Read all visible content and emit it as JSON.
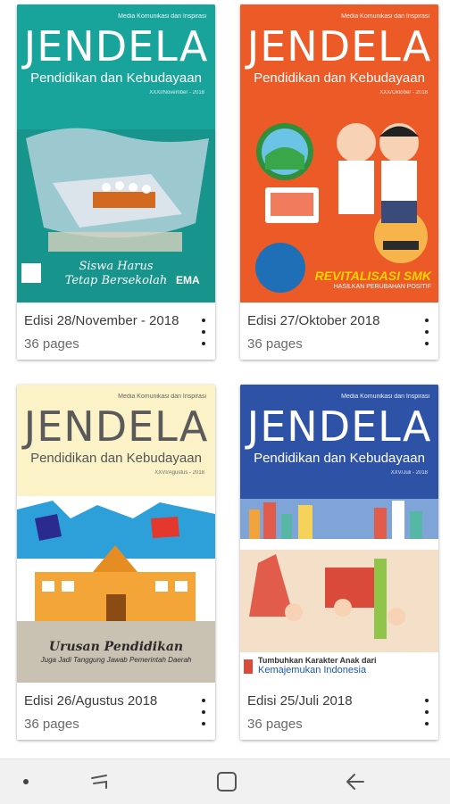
{
  "publications": [
    {
      "edition": "Edisi 28/November - 2018",
      "pages": "36 pages",
      "cover": {
        "kicker": "Media Komunikasi dan Inspirasi",
        "title": "JENDELA",
        "subtitle": "Pendidikan dan Kebudayaan",
        "issue": "XXXI/November - 2018",
        "headline_line1": "Siswa Harus",
        "headline_line2": "Tetap Bersekolah",
        "logo_text": "EMA",
        "bg": "#1aa39a"
      }
    },
    {
      "edition": "Edisi 27/Oktober 2018",
      "pages": "36 pages",
      "cover": {
        "kicker": "Media Komunikasi dan Inspirasi",
        "title": "JENDELA",
        "subtitle": "Pendidikan dan Kebudayaan",
        "issue": "XXX/Oktober - 2018",
        "headline_line1": "REVITALISASI SMK",
        "headline_line2": "HASILKAN PERUBAHAN POSITIF",
        "bg": "#ec5a27"
      }
    },
    {
      "edition": "Edisi 26/Agustus 2018",
      "pages": "36 pages",
      "cover": {
        "kicker": "Media Komunikasi dan Inspirasi",
        "title": "JENDELA",
        "subtitle": "Pendidikan dan Kebudayaan",
        "issue": "XXVI/Agustus - 2018",
        "headline_line1": "Urusan Pendidikan",
        "headline_line2": "Juga Jadi Tanggung Jawab Pemerintah Daerah",
        "bg": "#fbf2c8"
      }
    },
    {
      "edition": "Edisi 25/Juli 2018",
      "pages": "36 pages",
      "cover": {
        "kicker": "Media Komunikasi dan Inspirasi",
        "title": "JENDELA",
        "subtitle": "Pendidikan dan Kebudayaan",
        "issue": "XXV/Juli - 2018",
        "headline_line1": "Tumbuhkan Karakter Anak dari",
        "headline_line2": "Kemajemukan Indonesia",
        "bg": "#2e53a6"
      }
    }
  ],
  "navbar": {
    "icons": [
      "dot-indicator-icon",
      "recent-apps-icon",
      "home-icon",
      "back-icon"
    ]
  }
}
